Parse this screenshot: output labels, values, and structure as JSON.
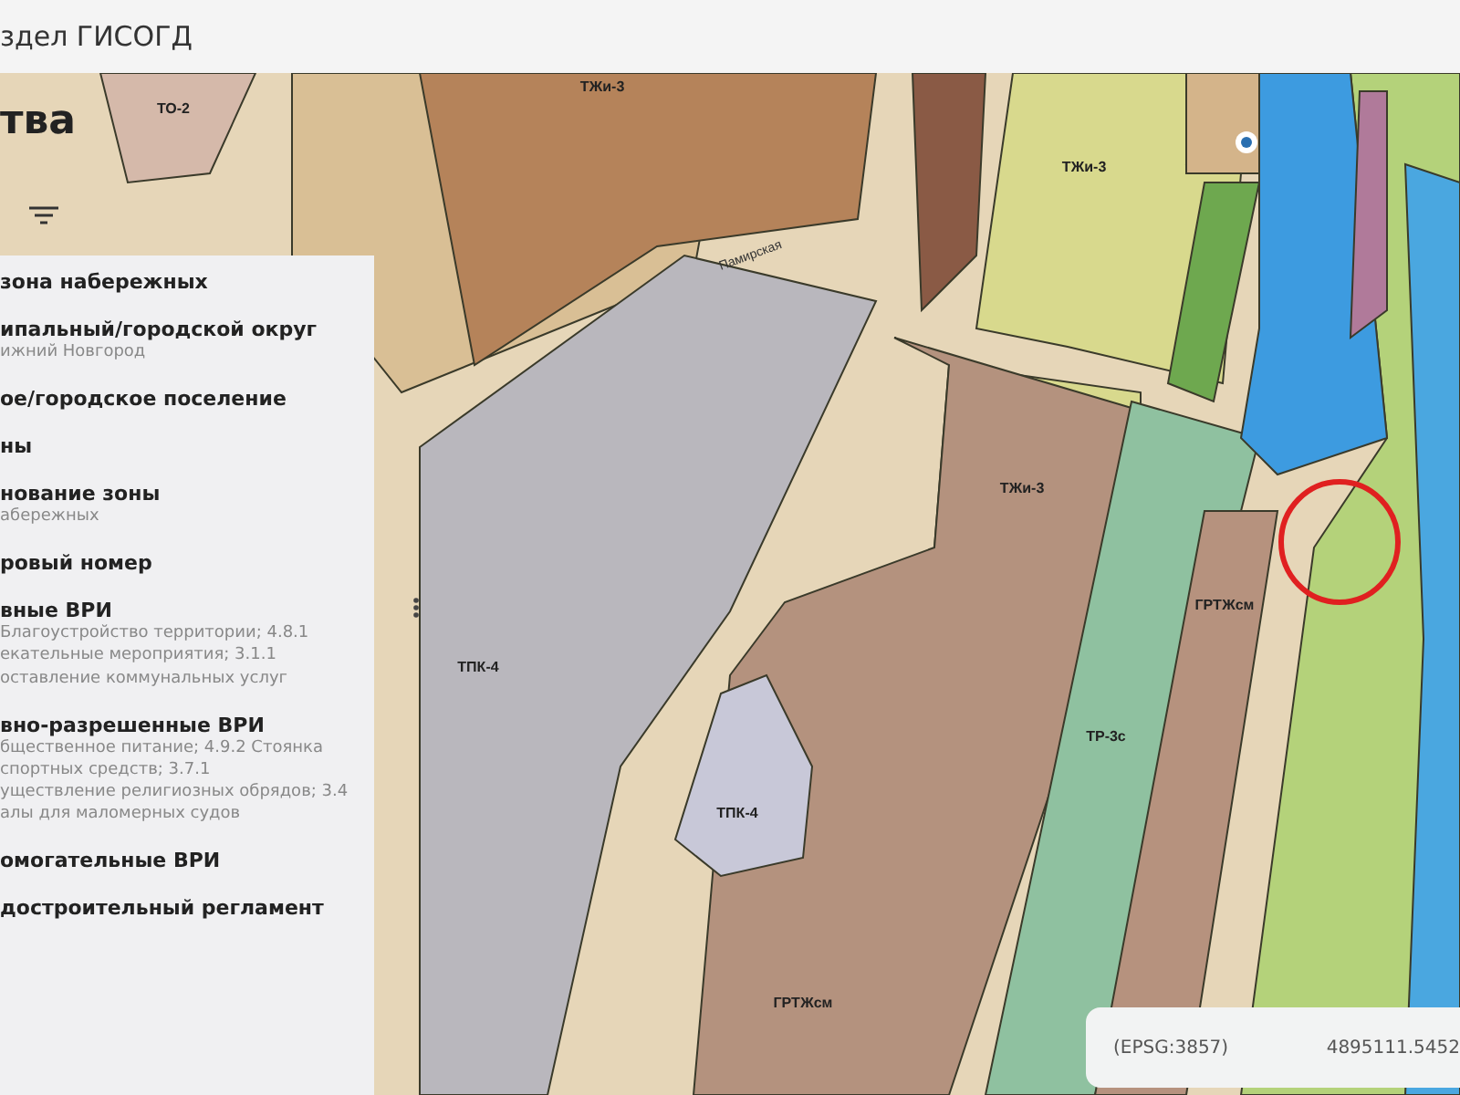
{
  "header": {
    "title": "здел ГИСОГД"
  },
  "page_title": "тва",
  "map": {
    "zone_labels": [
      "ТО-2",
      "ТЖи-3",
      "ТЖи-3",
      "ТЖи-3",
      "ТПК-4",
      "ТПК-4",
      "ТР-3с",
      "ГРТЖсм",
      "ГРТЖсм"
    ],
    "street_labels": [
      "Памирская"
    ]
  },
  "panel": {
    "sections": [
      {
        "label": "зона набережных"
      },
      {
        "label": "ипальный/городской округ",
        "lines": [
          "ижний Новгород"
        ]
      },
      {
        "label": "ое/городское поселение"
      },
      {
        "label": "ны"
      },
      {
        "label": "нование зоны",
        "lines": [
          "абережных"
        ]
      },
      {
        "label": "ровый номер"
      },
      {
        "label": "вные ВРИ",
        "lines": [
          "Благоустройство территории; 4.8.1",
          "екательные мероприятия; 3.1.1",
          "оставление коммунальных услуг"
        ]
      },
      {
        "label": "вно-разрешенные ВРИ",
        "lines": [
          "бщественное питание; 4.9.2 Стоянка",
          "спортных средств; 3.7.1",
          "уществление религиозных обрядов; 3.4",
          "алы для маломерных судов"
        ]
      },
      {
        "label": "омогательные ВРИ"
      },
      {
        "label": "достроительный регламент"
      }
    ]
  },
  "coords": {
    "crs": "(EPSG:3857)",
    "value": "4895111.5452"
  }
}
